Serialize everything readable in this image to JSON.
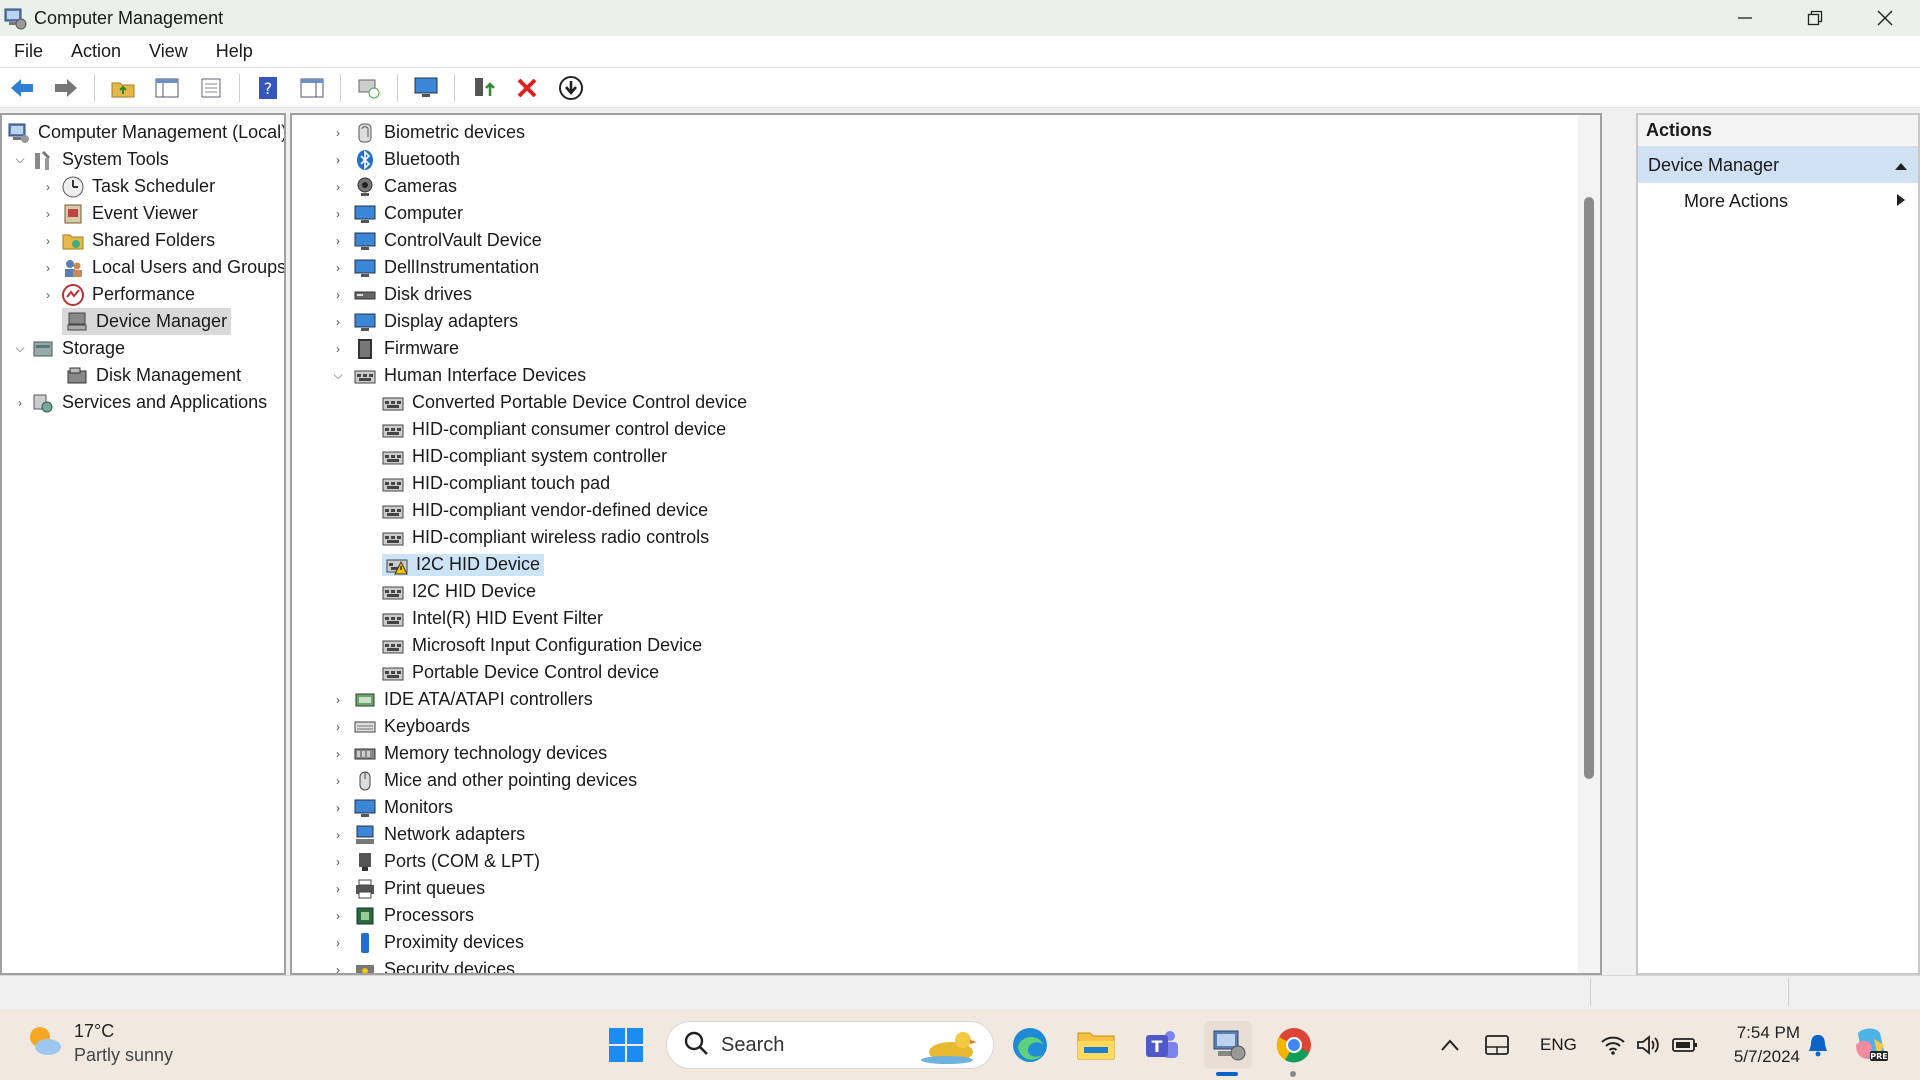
{
  "window": {
    "title": "Computer Management",
    "minimize": "—",
    "restore": "❐",
    "close": "✕"
  },
  "menu": [
    "File",
    "Action",
    "View",
    "Help"
  ],
  "tree": {
    "root": "Computer Management (Local)",
    "system_tools": "System Tools",
    "task_scheduler": "Task Scheduler",
    "event_viewer": "Event Viewer",
    "shared_folders": "Shared Folders",
    "local_users": "Local Users and Groups",
    "performance": "Performance",
    "device_manager": "Device Manager",
    "storage": "Storage",
    "disk_management": "Disk Management",
    "services": "Services and Applications"
  },
  "devices": {
    "categories": [
      "Biometric devices",
      "Bluetooth",
      "Cameras",
      "Computer",
      "ControlVault Device",
      "DellInstrumentation",
      "Disk drives",
      "Display adapters",
      "Firmware",
      "Human Interface Devices"
    ],
    "hid_children": [
      "Converted Portable Device Control device",
      "HID-compliant consumer control device",
      "HID-compliant system controller",
      "HID-compliant touch pad",
      "HID-compliant vendor-defined device",
      "HID-compliant wireless radio controls",
      "I2C HID Device",
      "I2C HID Device",
      "Intel(R) HID Event Filter",
      "Microsoft Input Configuration Device",
      "Portable Device Control device"
    ],
    "more_categories": [
      "IDE ATA/ATAPI controllers",
      "Keyboards",
      "Memory technology devices",
      "Mice and other pointing devices",
      "Monitors",
      "Network adapters",
      "Ports (COM & LPT)",
      "Print queues",
      "Processors",
      "Proximity devices",
      "Security devices"
    ]
  },
  "actions": {
    "header": "Actions",
    "section": "Device Manager",
    "more": "More Actions"
  },
  "taskbar": {
    "temp": "17°C",
    "weather": "Partly sunny",
    "search": "Search",
    "lang": "ENG",
    "time": "7:54 PM",
    "date": "5/7/2024"
  },
  "colors": {
    "titlebar": "#e9f1ea",
    "selection": "#cce4f7",
    "taskbar": "#f1e9e0",
    "accent": "#0a64c8"
  }
}
